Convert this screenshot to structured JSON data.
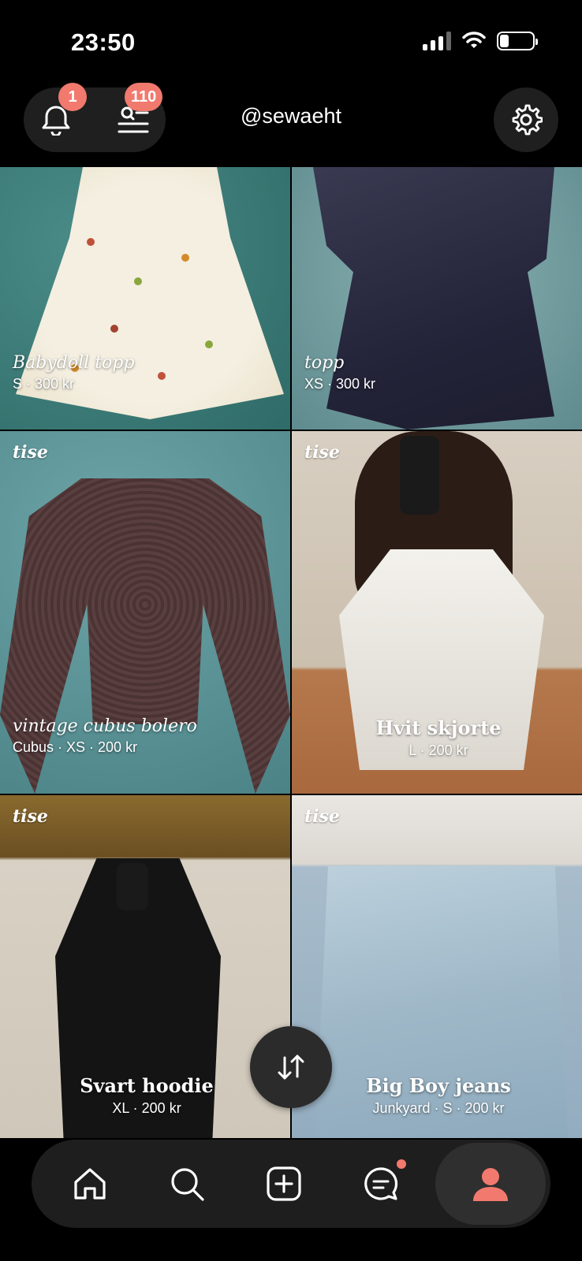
{
  "status_bar": {
    "time": "23:50"
  },
  "header": {
    "notifications_badge": "1",
    "lists_badge": "110",
    "handle": "@sewaeht"
  },
  "brand_watermark": "tise",
  "listings": [
    {
      "title": "Babydoll topp",
      "meta": "S · 300 kr"
    },
    {
      "title": "topp",
      "meta": "XS · 300 kr"
    },
    {
      "title": "vintage cubus bolero",
      "meta": "Cubus · XS · 200 kr"
    },
    {
      "title": "Hvit skjorte",
      "meta": "L · 200 kr"
    },
    {
      "title": "Svart hoodie",
      "meta": "XL · 200 kr"
    },
    {
      "title": "Big Boy jeans",
      "meta": "Junkyard · S · 200 kr"
    }
  ],
  "colors": {
    "accent": "#f2796e",
    "nav_bg": "#1e1e1e",
    "background": "#000000"
  },
  "icons": [
    "bell-icon",
    "search-list-icon",
    "gear-icon",
    "sort-icon",
    "home-icon",
    "search-icon",
    "add-icon",
    "chat-icon",
    "profile-icon"
  ]
}
